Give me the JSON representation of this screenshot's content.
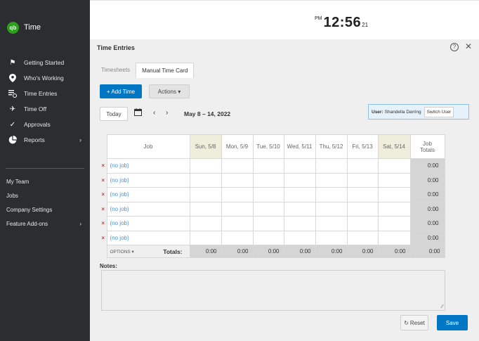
{
  "app": {
    "name": "Time",
    "logo": "qb"
  },
  "sidebar": {
    "items": [
      {
        "label": "Getting Started",
        "icon": "flag-icon"
      },
      {
        "label": "Who's Working",
        "icon": "location-pin-icon"
      },
      {
        "label": "Time Entries",
        "icon": "time-entries-icon"
      },
      {
        "label": "Time Off",
        "icon": "airplane-icon"
      },
      {
        "label": "Approvals",
        "icon": "approvals-check-icon"
      },
      {
        "label": "Reports",
        "icon": "pie-chart-icon",
        "has_submenu": true
      }
    ],
    "secondary": [
      {
        "label": "My Team"
      },
      {
        "label": "Jobs"
      },
      {
        "label": "Company Settings"
      },
      {
        "label": "Feature Add-ons",
        "has_submenu": true
      }
    ]
  },
  "clock": {
    "ampm": "PM",
    "time": "12:56",
    "seconds": "21"
  },
  "panel": {
    "title": "Time Entries",
    "tabs": [
      {
        "label": "Timesheets"
      },
      {
        "label": "Manual Time Card",
        "active": true
      }
    ],
    "add_time": "+ Add Time",
    "actions": "Actions ▾",
    "today": "Today",
    "date_range": "May 8 – 14, 2022",
    "user_label": "User:",
    "user_name": "Shandella Darring",
    "switch_user": "Switch User",
    "notes_label": "Notes:",
    "reset": "Reset",
    "save": "Save"
  },
  "grid": {
    "job_header": "Job",
    "days": [
      {
        "label": "Sun, 5/8",
        "weekend": true
      },
      {
        "label": "Mon, 5/9",
        "weekend": false
      },
      {
        "label": "Tue, 5/10",
        "weekend": false
      },
      {
        "label": "Wed, 5/11",
        "weekend": false
      },
      {
        "label": "Thu, 5/12",
        "weekend": false
      },
      {
        "label": "Fri, 5/13",
        "weekend": false
      },
      {
        "label": "Sat, 5/14",
        "weekend": true
      }
    ],
    "totals_header_1": "Job",
    "totals_header_2": "Totals",
    "rows": [
      {
        "job": "(no job)",
        "total": "0:00"
      },
      {
        "job": "(no job)",
        "total": "0:00"
      },
      {
        "job": "(no job)",
        "total": "0:00"
      },
      {
        "job": "(no job)",
        "total": "0:00"
      },
      {
        "job": "(no job)",
        "total": "0:00"
      },
      {
        "job": "(no job)",
        "total": "0:00"
      }
    ],
    "remove_mark": "×",
    "options_label": "OPTIONS ▾",
    "totals_label": "Totals:",
    "day_totals": [
      "0:00",
      "0:00",
      "0:00",
      "0:00",
      "0:00",
      "0:00",
      "0:00"
    ],
    "grand_total": "0:00"
  },
  "colors": {
    "sidebar": "#2b2d31",
    "brand": "#2ca01c",
    "primary": "#0077c5",
    "weekend": "#efeddc",
    "remove": "#d03b3b"
  }
}
